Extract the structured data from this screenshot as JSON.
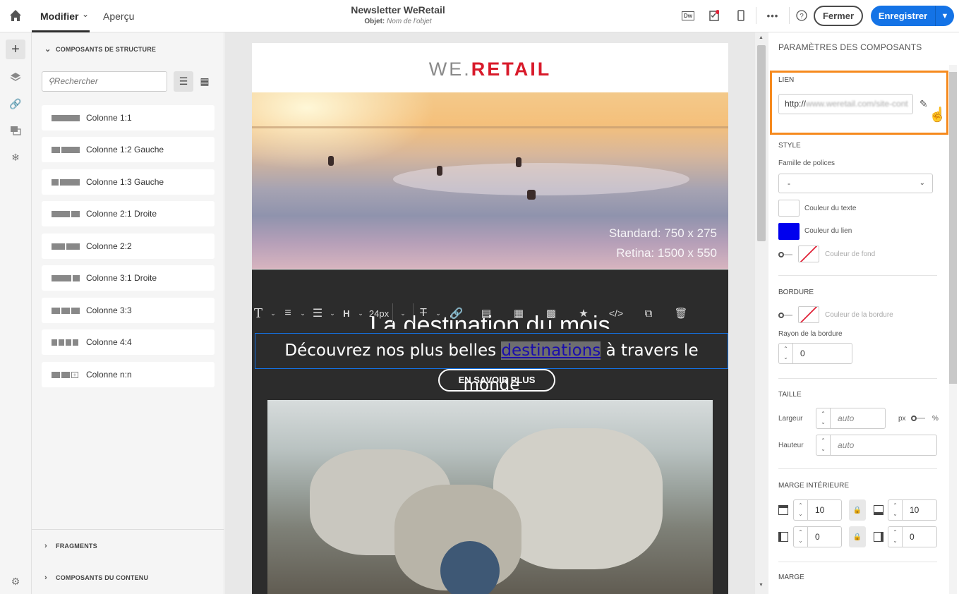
{
  "topbar": {
    "tabs": {
      "modifier": "Modifier",
      "apercu": "Aperçu"
    },
    "title": "Newsletter WeRetail",
    "subject_label": "Objet:",
    "subject_value": "Nom de l'objet",
    "icons": [
      "dreamweaver-icon",
      "checklist-icon",
      "mobile-icon",
      "more-icon",
      "help-icon"
    ],
    "dw_label": "Dw",
    "close_label": "Fermer",
    "save_label": "Enregistrer"
  },
  "left_panel": {
    "structure_title": "COMPOSANTS DE STRUCTURE",
    "search_placeholder": "Rechercher",
    "components": [
      {
        "label": "Colonne 1:1"
      },
      {
        "label": "Colonne 1:2 Gauche"
      },
      {
        "label": "Colonne 1:3 Gauche"
      },
      {
        "label": "Colonne 2:1 Droite"
      },
      {
        "label": "Colonne 2:2"
      },
      {
        "label": "Colonne 3:1 Droite"
      },
      {
        "label": "Colonne 3:3"
      },
      {
        "label": "Colonne 4:4"
      },
      {
        "label": "Colonne n:n"
      }
    ],
    "fragments_title": "FRAGMENTS",
    "content_title": "COMPOSANTS DU CONTENU"
  },
  "email": {
    "logo_we": "WE.",
    "logo_retail": "RETAIL",
    "hero_line1": "Standard: 750 x 275",
    "hero_line2": "Retina: 1500 x 550",
    "headline": "La destination du mois",
    "toolbar_size": "24px",
    "text_before": "Découvrez nos plus belles ",
    "text_link": "destinations",
    "text_after": " à travers le monde",
    "cta": "EN SAVOIR PLUS"
  },
  "right_panel": {
    "title": "PARAMÈTRES DES COMPOSANTS",
    "lien_label": "LIEN",
    "lien_url": "http://",
    "lien_url_blurred": "www.weretail.com/site-cont",
    "style_label": "STYLE",
    "font_family_label": "Famille de polices",
    "font_family_value": "-",
    "text_color_label": "Couleur du texte",
    "link_color_label": "Couleur du lien",
    "bg_color_label": "Couleur de fond",
    "border_label": "BORDURE",
    "border_color_label": "Couleur de la bordure",
    "border_radius_label": "Rayon de la bordure",
    "border_radius_value": "0",
    "size_label": "TAILLE",
    "width_label": "Largeur",
    "height_label": "Hauteur",
    "size_placeholder": "auto",
    "unit_px": "px",
    "unit_pct": "%",
    "padding_label": "MARGE INTÉRIEURE",
    "padding_top": "10",
    "padding_bottom": "10",
    "padding_left": "0",
    "padding_right": "0",
    "margin_label": "MARGE",
    "colors": {
      "text": "#ffffff",
      "link": "#0000ee",
      "highlight": "#f68a1e",
      "accent": "#1473e6"
    }
  }
}
